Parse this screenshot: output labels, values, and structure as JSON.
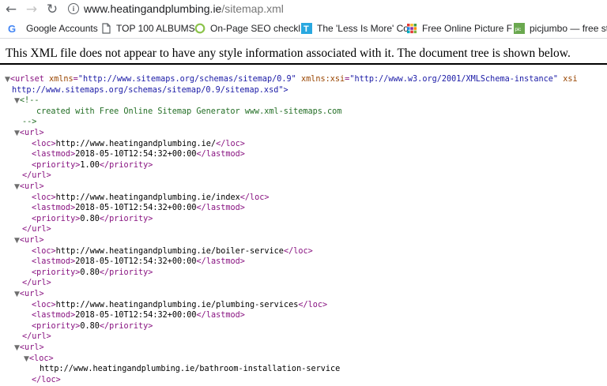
{
  "browser": {
    "url_host": "www.heatingandplumbing.ie",
    "url_path": "/sitemap.xml",
    "bookmarks": [
      {
        "label": "Google Accounts",
        "icon": "google-icon"
      },
      {
        "label": "TOP 100 ALBUMS",
        "icon": "page-icon"
      },
      {
        "label": "On-Page SEO checkl",
        "icon": "circle-icon"
      },
      {
        "label": "The 'Less Is More' Co",
        "icon": "letter-t-icon"
      },
      {
        "label": "Free Online Picture F",
        "icon": "grid-icon"
      },
      {
        "label": "picjumbo — free sto",
        "icon": "pic-icon"
      }
    ]
  },
  "notice": "This XML file does not appear to have any style information associated with it. The document tree is shown below.",
  "xml": {
    "urlset_open": "<urlset",
    "attr1_name": "xmlns",
    "attr1_value": "\"http://www.sitemaps.org/schemas/sitemap/0.9\"",
    "attr2_name": "xmlns:xsi",
    "attr2_value": "\"http://www.w3.org/2001/XMLSchema-instance\"",
    "attr3_name": "xsi",
    "schema_continuation": "http://www.sitemaps.org/schemas/sitemap/0.9/sitemap.xsd\">",
    "comment_open": "<!--",
    "comment_text": "created with Free Online Sitemap Generator www.xml-sitemaps.com",
    "comment_close": "-->",
    "urls": [
      {
        "loc": "http://www.heatingandplumbing.ie/",
        "lastmod": "2018-05-10T12:54:32+00:00",
        "priority": "1.00"
      },
      {
        "loc": "http://www.heatingandplumbing.ie/index",
        "lastmod": "2018-05-10T12:54:32+00:00",
        "priority": "0.80"
      },
      {
        "loc": "http://www.heatingandplumbing.ie/boiler-service",
        "lastmod": "2018-05-10T12:54:32+00:00",
        "priority": "0.80"
      },
      {
        "loc": "http://www.heatingandplumbing.ie/plumbing-services",
        "lastmod": "2018-05-10T12:54:32+00:00",
        "priority": "0.80"
      },
      {
        "loc": "http://www.heatingandplumbing.ie/bathroom-installation-service"
      }
    ],
    "tags": {
      "url_open": "<url>",
      "url_close": "</url>",
      "loc_open": "<loc>",
      "loc_close": "</loc>",
      "lastmod_open": "<lastmod>",
      "lastmod_close": "</lastmod>",
      "priority_open": "<priority>",
      "priority_close": "</priority>"
    }
  }
}
